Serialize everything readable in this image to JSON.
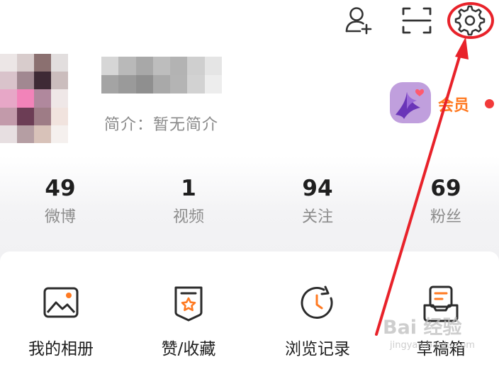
{
  "header_icons": [
    {
      "name": "add-friend-icon"
    },
    {
      "name": "scan-icon"
    },
    {
      "name": "settings-icon"
    }
  ],
  "profile": {
    "bio": "简介：暂无简介",
    "vip_label": "会员"
  },
  "stats": [
    {
      "value": "49",
      "label": "微博"
    },
    {
      "value": "1",
      "label": "视频"
    },
    {
      "value": "94",
      "label": "关注"
    },
    {
      "value": "69",
      "label": "粉丝"
    }
  ],
  "functions": [
    {
      "label": "我的相册",
      "icon": "photo-album-icon"
    },
    {
      "label": "赞/收藏",
      "icon": "bookmark-star-icon"
    },
    {
      "label": "浏览记录",
      "icon": "history-clock-icon"
    },
    {
      "label": "草稿箱",
      "icon": "draft-box-icon"
    }
  ],
  "colors": {
    "accent": "#ff7a22",
    "annotation": "#e8222a"
  },
  "watermark": {
    "main": "Bai 经验",
    "sub": "jingyan.baidu.com"
  }
}
